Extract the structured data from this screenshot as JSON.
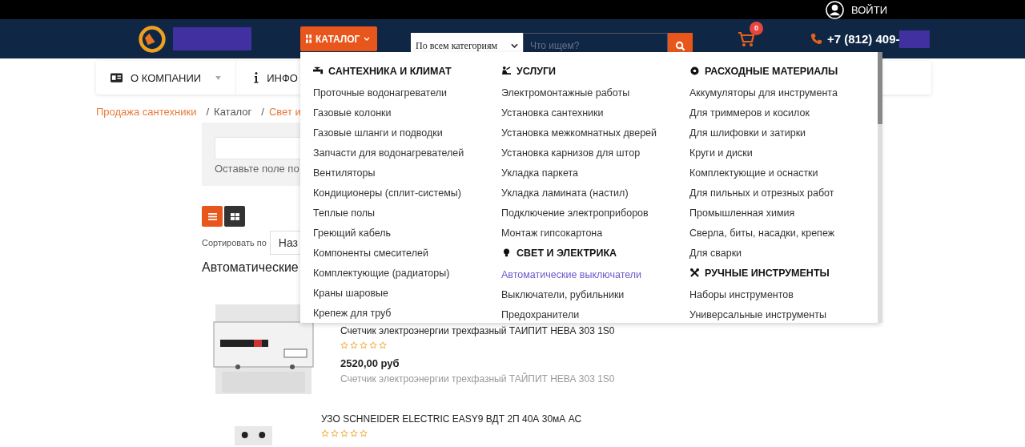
{
  "top_bar": {
    "login": "ВОЙТИ"
  },
  "header": {
    "catalog_button": "КАТАЛОГ",
    "category_select": "По всем категориям",
    "search": {
      "placeholder": "Что ищем?"
    },
    "cart_count": "0",
    "phone": "+7 (812) 409-"
  },
  "nav": [
    {
      "label": "О КОМПАНИИ",
      "kind": "card",
      "has_caret": true
    },
    {
      "label": "ИНФО",
      "kind": "info",
      "has_caret": false
    }
  ],
  "breadcrumbs": [
    {
      "label": "Продажа сантехники",
      "link": true
    },
    {
      "separator": "/",
      "label": "Каталог",
      "link": false
    },
    {
      "separator": "/",
      "label": "Свет и",
      "link": true
    }
  ],
  "filter": {
    "hint": "Оставьте поле по"
  },
  "view_toggle": [
    {
      "kind": "list",
      "selected": true
    },
    {
      "kind": "grid",
      "selected": false
    }
  ],
  "sort": {
    "label": "Сортировать по",
    "value": "Наз"
  },
  "heading": "Автоматические",
  "products": [
    {
      "title": "Счетчик электроэнергии трехфазный ТАИПИТ НЕВА 303 1S0",
      "stars": 0,
      "price": "2520,00 руб",
      "description": "Счетчик электроэнергии трехфазный ТАЙПИТ НЕВА 303 1S0",
      "kind": "meter"
    },
    {
      "title": "УЗО SCHNEIDER ELECTRIC EASY9 ВДТ 2П 40А 30мА АС",
      "stars": 0,
      "kind": "rcd"
    }
  ],
  "menu": {
    "columns": [
      {
        "sections": [
          {
            "title": "САНТЕХНИКА И КЛИМАТ",
            "kind": "faucet",
            "items": [
              {
                "label": "Проточные водонагреватели",
                "selected": false
              },
              {
                "label": "Газовые колонки",
                "selected": false
              },
              {
                "label": "Газовые шланги и подводки",
                "selected": false
              },
              {
                "label": "Запчасти для водонагревателей",
                "selected": false
              },
              {
                "label": "Вентиляторы",
                "selected": false
              },
              {
                "label": "Кондиционеры (сплит-системы)",
                "selected": false
              },
              {
                "label": "Теплые полы",
                "selected": false
              },
              {
                "label": "Греющий кабель",
                "selected": false
              },
              {
                "label": "Компоненты смесителей",
                "selected": false
              },
              {
                "label": "Комплектующие (радиаторы)",
                "selected": false
              },
              {
                "label": "Краны шаровые",
                "selected": false
              },
              {
                "label": "Крепеж для труб",
                "selected": false
              }
            ]
          }
        ]
      },
      {
        "sections": [
          {
            "title": "УСЛУГИ",
            "kind": "worker",
            "items": [
              {
                "label": "Электромонтажные работы",
                "selected": false
              },
              {
                "label": "Установка сантехники",
                "selected": false
              },
              {
                "label": "Установка межкомнатных дверей",
                "selected": false
              },
              {
                "label": "Установка карнизов для штор",
                "selected": false
              },
              {
                "label": "Укладка паркета",
                "selected": false
              },
              {
                "label": "Укладка ламината (настил)",
                "selected": false
              },
              {
                "label": "Подключение электроприборов",
                "selected": false
              },
              {
                "label": "Монтаж гипсокартона",
                "selected": false
              }
            ]
          },
          {
            "title": "СВЕТ И ЭЛЕКТРИКА",
            "kind": "bulb",
            "items": [
              {
                "label": "Автоматические выключатели",
                "selected": true
              },
              {
                "label": "Выключатели, рубильники",
                "selected": false
              },
              {
                "label": "Предохранители",
                "selected": false
              }
            ]
          }
        ]
      },
      {
        "sections": [
          {
            "title": "РАСХОДНЫЕ МАТЕРИАЛЫ",
            "kind": "disc",
            "items": [
              {
                "label": "Аккумуляторы для инструмента",
                "selected": false
              },
              {
                "label": "Для триммеров и косилок",
                "selected": false
              },
              {
                "label": "Для шлифовки и затирки",
                "selected": false
              },
              {
                "label": "Круги и диски",
                "selected": false
              },
              {
                "label": "Комплектующие и оснастки",
                "selected": false
              },
              {
                "label": "Для пильных и отрезных работ",
                "selected": false
              },
              {
                "label": "Промышленная химия",
                "selected": false
              },
              {
                "label": "Сверла, биты, насадки, крепеж",
                "selected": false
              },
              {
                "label": "Для сварки",
                "selected": false
              }
            ]
          },
          {
            "title": "РУЧНЫЕ ИНСТРУМЕНТЫ",
            "kind": "tools",
            "items": [
              {
                "label": "Наборы инструментов",
                "selected": false
              },
              {
                "label": "Универсальные инструменты",
                "selected": false
              }
            ]
          }
        ]
      }
    ]
  }
}
